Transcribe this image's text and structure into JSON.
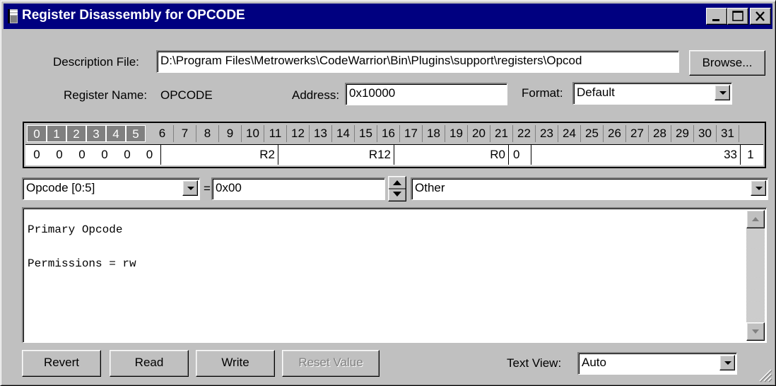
{
  "window": {
    "title": "Register Disassembly for OPCODE",
    "controls": {
      "minimize": "_",
      "maximize": "□",
      "close": "×"
    }
  },
  "description": {
    "label": "Description File:",
    "value": "D:\\Program Files\\Metrowerks\\CodeWarrior\\Bin\\Plugins\\support\\registers\\Opcod",
    "browse_label": "Browse..."
  },
  "register": {
    "name_label": "Register Name:",
    "name_value": "OPCODE",
    "address_label": "Address:",
    "address_value": "0x10000",
    "format_label": "Format:",
    "format_value": "Default"
  },
  "bits": {
    "numbers": [
      "0",
      "1",
      "2",
      "3",
      "4",
      "5",
      "6",
      "7",
      "8",
      "9",
      "10",
      "11",
      "12",
      "13",
      "14",
      "15",
      "16",
      "17",
      "18",
      "19",
      "20",
      "21",
      "22",
      "23",
      "24",
      "25",
      "26",
      "27",
      "28",
      "29",
      "30",
      "31"
    ],
    "selected": [
      0,
      1,
      2,
      3,
      4,
      5
    ],
    "values": [
      "0",
      "0",
      "0",
      "0",
      "0",
      "0",
      "R2",
      "R12",
      "R0",
      "0",
      "33",
      "1"
    ]
  },
  "field": {
    "select_value": "Opcode [0:5]",
    "equals": "=",
    "value": "0x00",
    "interpretation": "Other"
  },
  "text_view": {
    "lines": [
      "Primary Opcode",
      "",
      "Permissions = rw"
    ],
    "label": "Text View:",
    "value": "Auto"
  },
  "buttons": {
    "revert": "Revert",
    "read": "Read",
    "write": "Write",
    "reset": "Reset Value"
  },
  "colors": {
    "title_bar": "#000080",
    "face": "#c0c0c0",
    "selected_bit": "#808080"
  },
  "icons": [
    "app-icon",
    "minimize-icon",
    "maximize-icon",
    "close-icon",
    "dropdown-arrow-icon",
    "spin-arrows-icon",
    "scroll-up-icon",
    "scroll-down-icon",
    "size-grip-icon"
  ]
}
